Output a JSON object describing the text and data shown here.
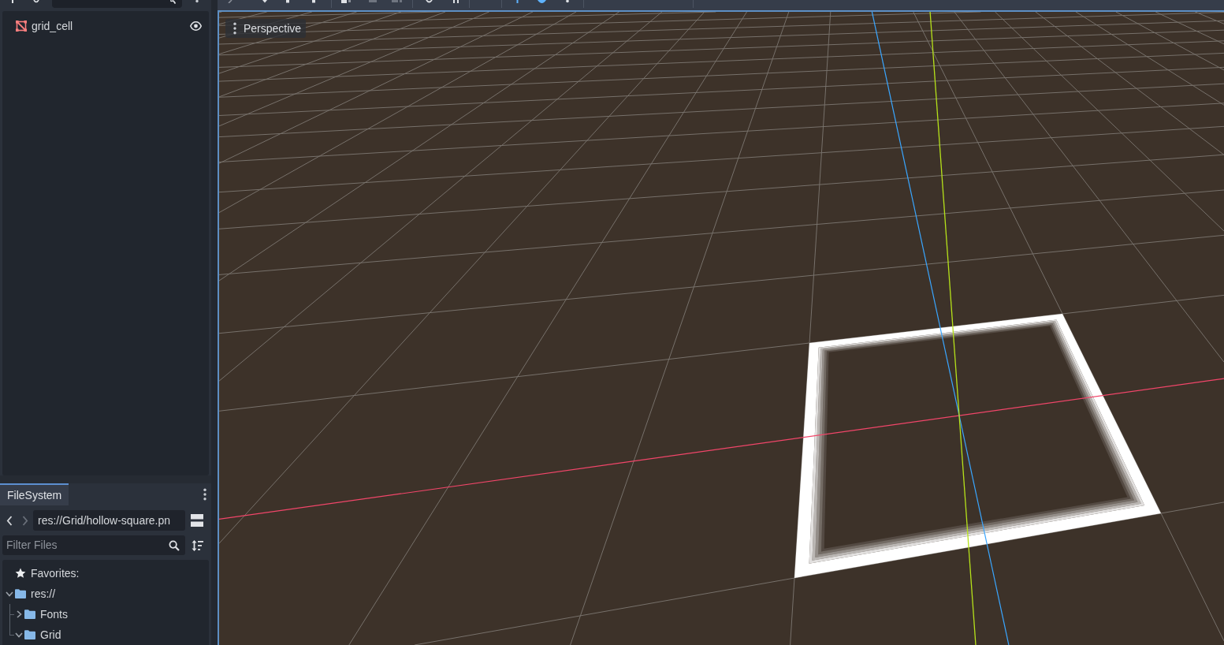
{
  "scene_dock": {
    "nodes": [
      {
        "name": "grid_cell",
        "visible": true
      }
    ]
  },
  "filesystem_dock": {
    "tabs": [
      {
        "label": "FileSystem",
        "selected": true
      }
    ],
    "history": [
      {
        "kind": "back",
        "disabled": false
      },
      {
        "kind": "forward",
        "disabled": true
      }
    ],
    "path": "res://Grid/hollow-square.pn",
    "filter": {
      "placeholder": "Filter Files"
    },
    "tree": [
      {
        "kind": "favorites",
        "label": "Favorites:"
      },
      {
        "kind": "folder",
        "label": "res://",
        "expanded": true,
        "children": [
          {
            "kind": "folder",
            "label": "Fonts",
            "expanded": false
          },
          {
            "kind": "folder",
            "label": "Grid",
            "expanded": true
          }
        ]
      }
    ]
  },
  "viewport": {
    "view_menu": {
      "label": "Perspective"
    }
  }
}
